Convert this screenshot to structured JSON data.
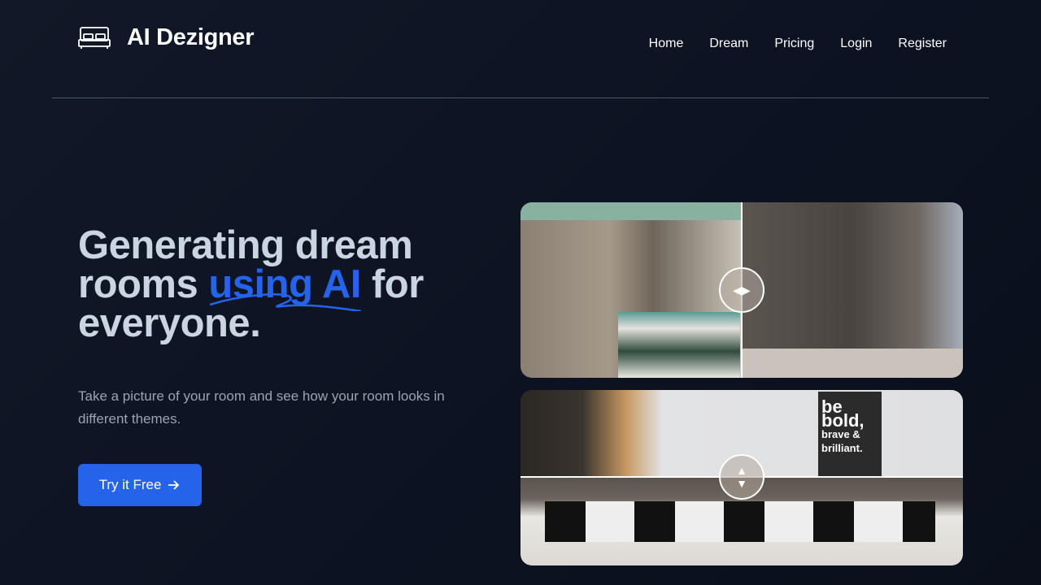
{
  "brand": {
    "name": "AI Dezigner",
    "icon": "bed-icon"
  },
  "nav": [
    "Home",
    "Dream",
    "Pricing",
    "Login",
    "Register"
  ],
  "hero": {
    "title_pre": "Generating dream rooms ",
    "title_highlight": "using AI",
    "title_post": " for everyone.",
    "subtitle": "Take a picture of your room and see how your room looks in different themes.",
    "cta": "Try it Free",
    "cta_icon": "arrow-right-icon",
    "accent": "#2563eb"
  },
  "comparisons": [
    {
      "orientation": "horizontal",
      "handle_icon": "left-right-arrows-icon"
    },
    {
      "orientation": "vertical",
      "handle_icon": "up-down-arrows-icon",
      "poster": {
        "line1": "be",
        "line2": "bold,",
        "line3": "brave &",
        "line4": "brilliant."
      }
    }
  ]
}
